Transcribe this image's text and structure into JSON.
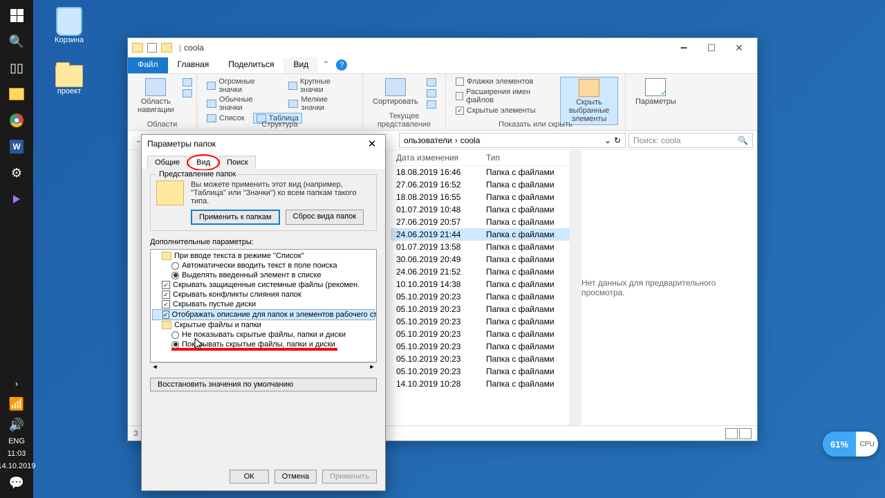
{
  "desktop": {
    "recycle": "Корзина",
    "project": "проект"
  },
  "taskbar": {
    "lang": "ENG",
    "time": "11:03",
    "date": "14.10.2019"
  },
  "explorer": {
    "title": "coola",
    "tabs": {
      "file": "Файл",
      "home": "Главная",
      "share": "Поделиться",
      "view": "Вид"
    },
    "ribbon": {
      "panes_label": "Области",
      "panes_nav": "Область навигации",
      "layout_label": "Структура",
      "layout": {
        "huge": "Огромные значки",
        "large": "Крупные значки",
        "medium": "Обычные значки",
        "small": "Мелкие значки",
        "list": "Список",
        "table": "Таблица"
      },
      "current_label": "Текущее представление",
      "sort": "Сортировать",
      "show_label": "Показать или скрыть",
      "show": {
        "checkboxes": "Флажки элементов",
        "extensions": "Расширения имен файлов",
        "hidden": "Скрытые элементы"
      },
      "hide_selected": "Скрыть выбранные элементы",
      "options": "Параметры"
    },
    "breadcrumb": {
      "users": "ользователи",
      "folder": "coola",
      "refresh": "↻"
    },
    "search_placeholder": "Поиск: coola",
    "cols": {
      "date": "Дата изменения",
      "type": "Тип"
    },
    "type_value": "Папка с файлами",
    "rows": [
      "18.08.2019 16:46",
      "27.06.2019 16:52",
      "18.08.2019 16:55",
      "01.07.2019 10:48",
      "27.06.2019 20:57",
      "24.06.2019 21:44",
      "01.07.2019 13:58",
      "30.06.2019 20:49",
      "24.06.2019 21:52",
      "10.10.2019 14:38",
      "05.10.2019 20:23",
      "05.10.2019 20:23",
      "05.10.2019 20:23",
      "05.10.2019 20:23",
      "05.10.2019 20:23",
      "05.10.2019 20:23",
      "05.10.2019 20:23",
      "14.10.2019 10:28"
    ],
    "preview_text": "Нет данных для предварительного просмотра.",
    "status_count": "З"
  },
  "dialog": {
    "title": "Параметры папок",
    "tabs": {
      "general": "Общие",
      "view": "Вид",
      "search": "Поиск"
    },
    "folder_views": {
      "group": "Представление папок",
      "text": "Вы можете применить этот вид (например, \"Таблица\" или \"Значки\") ко всем папкам такого типа.",
      "apply": "Применить к папкам",
      "reset": "Сброс вида папок"
    },
    "advanced_label": "Дополнительные параметры:",
    "tree": {
      "node_list_mode": "При вводе текста в режиме \"Список\"",
      "auto_search": "Автоматически вводить текст в поле поиска",
      "select_item": "Выделять введенный элемент в списке",
      "hide_protected": "Скрывать защищенные системные файлы (рекомен.",
      "hide_merge": "Скрывать конфликты слияния папок",
      "hide_empty": "Скрывать пустые диски",
      "show_desc": "Отображать описание для папок и элементов рабочего стола",
      "hidden_files": "Скрытые файлы и папки",
      "dont_show": "Не показывать скрытые файлы, папки и диски",
      "show_hidden": "Показывать скрытые файлы, папки и диски"
    },
    "restore": "Восстановить значения по умолчанию",
    "ok": "ОК",
    "cancel": "Отмена",
    "apply": "Применить"
  },
  "cpu": {
    "pct": "61%",
    "label": "CPU"
  }
}
